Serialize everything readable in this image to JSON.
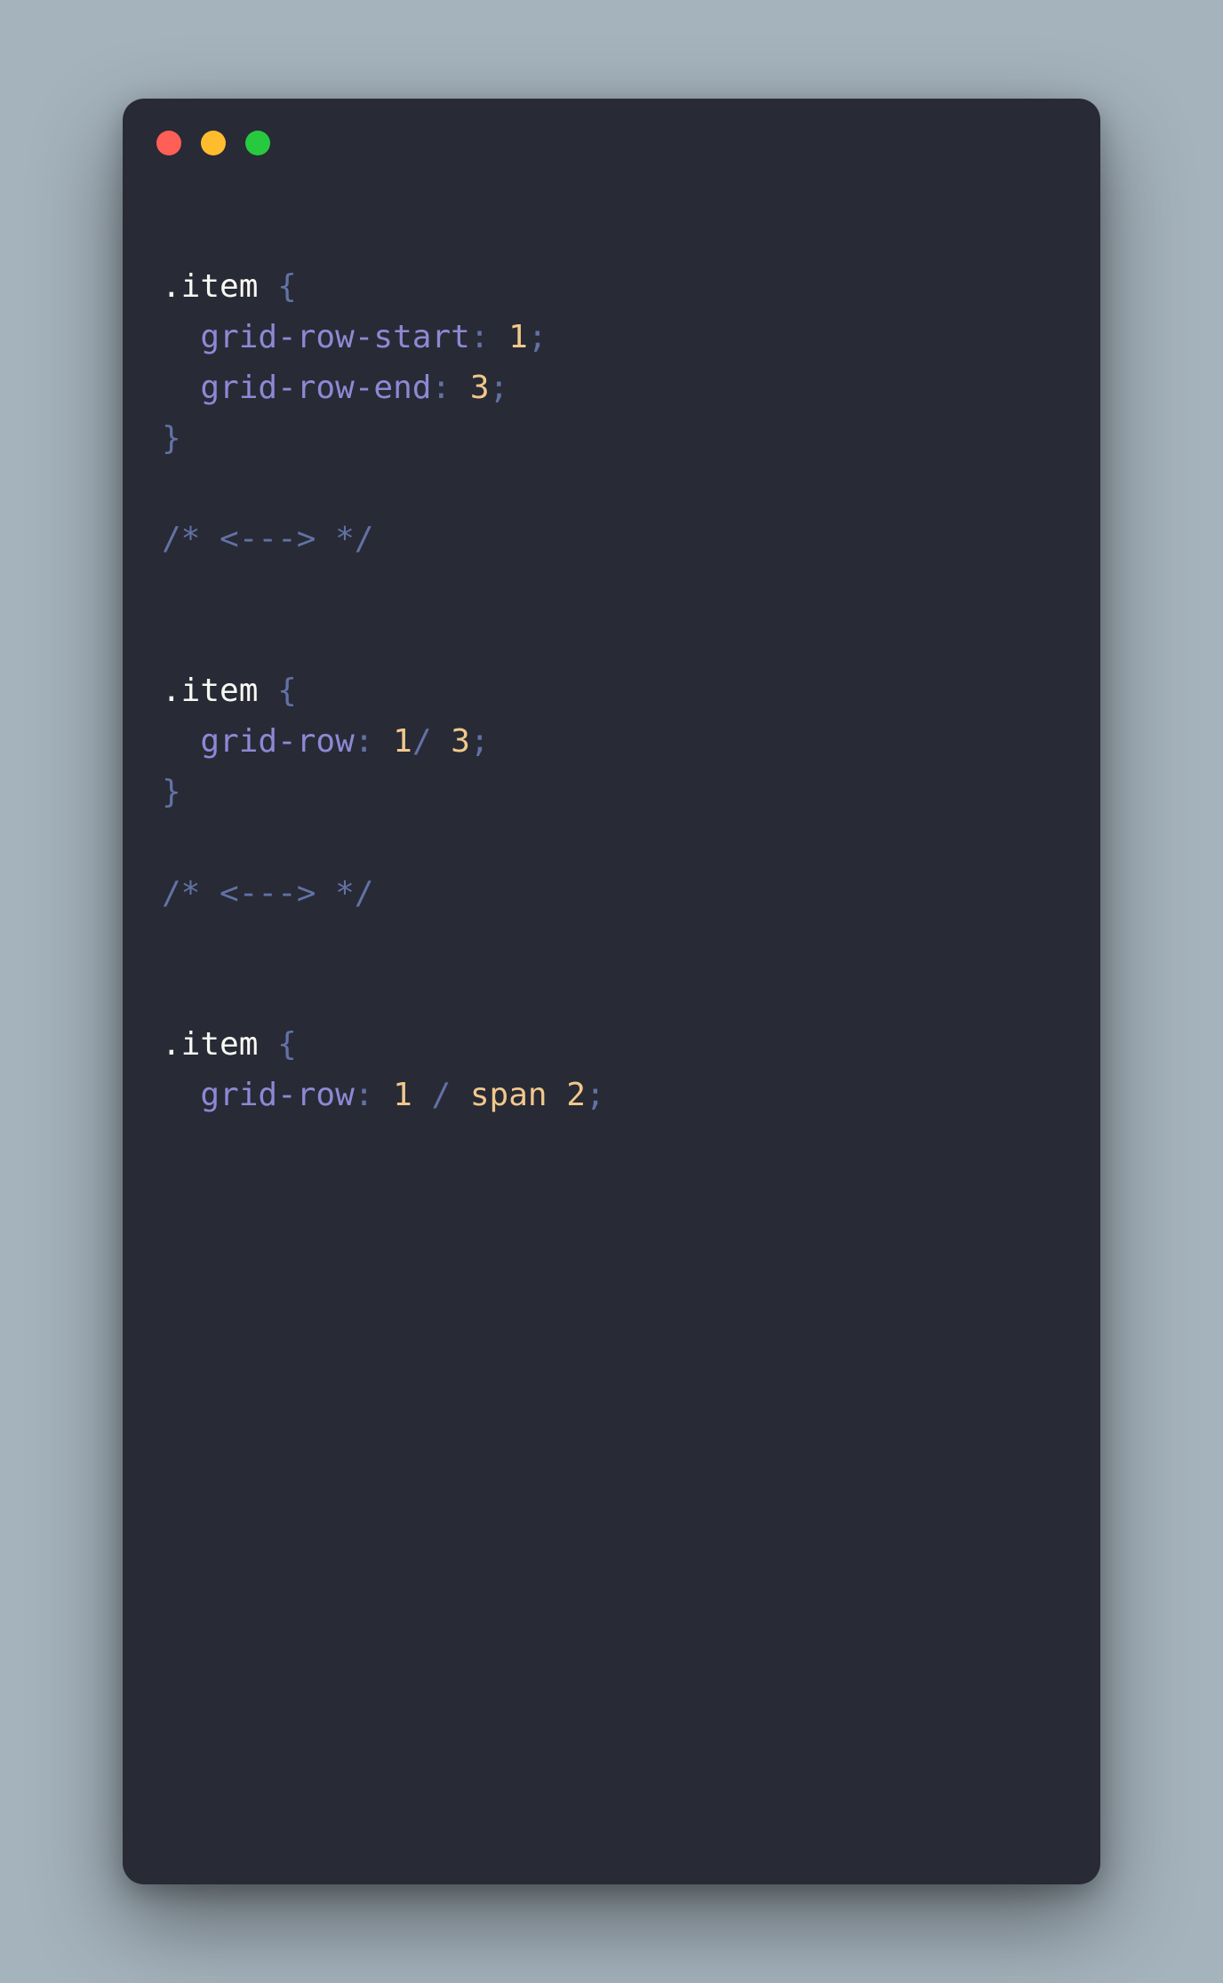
{
  "colors": {
    "background": "#a5b3bd",
    "window_bg": "#282a36",
    "red": "#ff5f56",
    "yellow": "#ffbd2e",
    "green": "#27c93f",
    "selector": "#f8f8f2",
    "property": "#8e88d4",
    "number": "#f1c88a",
    "punctuation": "#6272a4",
    "comment": "#6272a4"
  },
  "code_blocks": [
    {
      "selector": ".item",
      "declarations": [
        {
          "property": "grid-row-start",
          "value_tokens": [
            {
              "t": "num",
              "v": "1"
            }
          ]
        },
        {
          "property": "grid-row-end",
          "value_tokens": [
            {
              "t": "num",
              "v": "3"
            }
          ]
        }
      ]
    },
    {
      "selector": ".item",
      "declarations": [
        {
          "property": "grid-row",
          "value_tokens": [
            {
              "t": "num",
              "v": "1"
            },
            {
              "t": "punc",
              "v": "/"
            },
            {
              "t": "space",
              "v": " "
            },
            {
              "t": "num",
              "v": "3"
            }
          ]
        }
      ]
    },
    {
      "selector": ".item",
      "declarations": [
        {
          "property": "grid-row",
          "value_tokens": [
            {
              "t": "num",
              "v": "1"
            },
            {
              "t": "space",
              "v": " "
            },
            {
              "t": "punc",
              "v": "/"
            },
            {
              "t": "space",
              "v": " "
            },
            {
              "t": "kw",
              "v": "span"
            },
            {
              "t": "space",
              "v": " "
            },
            {
              "t": "num",
              "v": "2"
            }
          ]
        }
      ]
    }
  ],
  "separator_comment": "/* <---> */"
}
